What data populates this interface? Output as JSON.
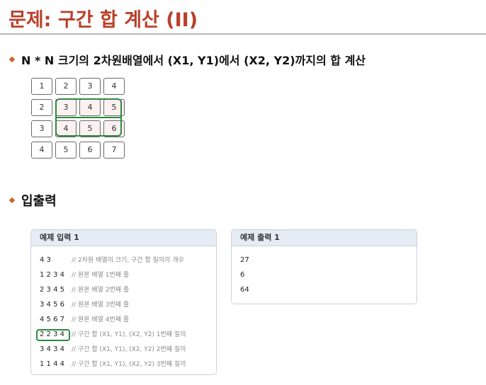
{
  "header": {
    "title": "문제: 구간 합 계산 (II)"
  },
  "section1": {
    "heading": "N * N 크기의 2차원배열에서 (X1, Y1)에서 (X2, Y2)까지의 합 계산",
    "grid": [
      [
        "1",
        "2",
        "3",
        "4"
      ],
      [
        "2",
        "3",
        "4",
        "5"
      ],
      [
        "3",
        "4",
        "5",
        "6"
      ],
      [
        "4",
        "5",
        "6",
        "7"
      ]
    ]
  },
  "section2": {
    "heading": "입출력"
  },
  "input_panel": {
    "title": "예제 입력 1",
    "lines": [
      {
        "value": "4 3",
        "comment": "// 2차원 배열의 크기, 구간 합 질의의 개수"
      },
      {
        "value": "1 2 3 4",
        "comment": "// 원본 배열 1번째 줄"
      },
      {
        "value": "2 3 4 5",
        "comment": "// 원본 배열 2번째 줄"
      },
      {
        "value": "3 4 5 6",
        "comment": "// 원본 배열 3번째 줄"
      },
      {
        "value": "4 5 6 7",
        "comment": "// 원본 배열 4번째 줄"
      },
      {
        "value": "2 2 3 4",
        "comment": "// 구간 합 (X1, Y1), (X2, Y2) 1번째 질의"
      },
      {
        "value": "3 4 3 4",
        "comment": "// 구간 합 (X1, Y1), (X2, Y2) 2번째 질의"
      },
      {
        "value": "1 1 4 4",
        "comment": "// 구간 합 (X1, Y1), (X2, Y2) 3번째 질의"
      }
    ]
  },
  "output_panel": {
    "title": "예제 출력 1",
    "lines": [
      "27",
      "6",
      "64"
    ]
  },
  "colors": {
    "title": "#b8402a",
    "bullet": "#c9652e",
    "highlight": "#2d8a3e",
    "panel_header": "#e6ecf5"
  }
}
